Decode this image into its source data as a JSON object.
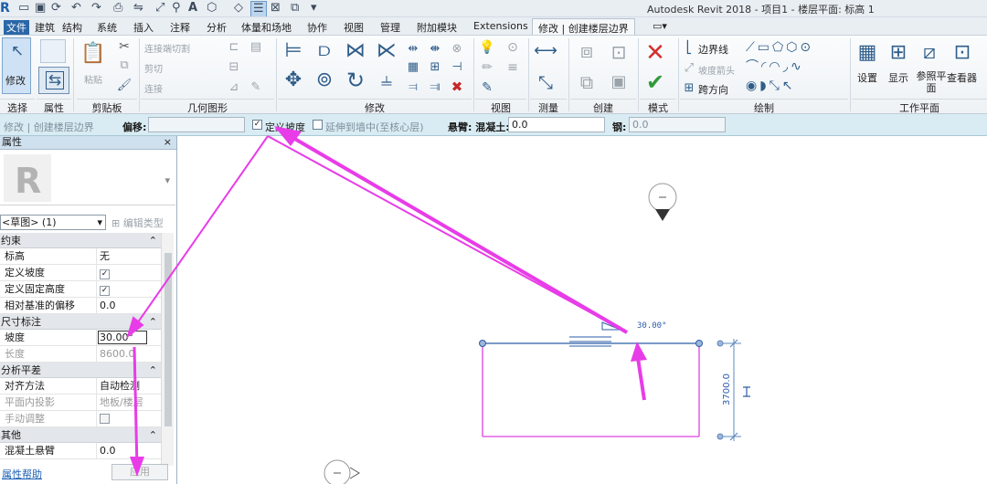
{
  "titlebar": {
    "logo": "R",
    "title": "Autodesk Revit 2018 -    项目1 - 楼层平面: 标高 1"
  },
  "tabs": [
    "文件",
    "建筑",
    "结构",
    "系统",
    "插入",
    "注释",
    "分析",
    "体量和场地",
    "协作",
    "视图",
    "管理",
    "附加模块",
    "Extensions",
    "修改 | 创建楼层边界"
  ],
  "ribbon": {
    "modify": "修改",
    "select": "选择",
    "properties": "属性",
    "paste": "粘贴",
    "clipboard": "剪贴板",
    "cut_join": "连接端切割",
    "cut": "剪切",
    "join": "连接",
    "geometry": "几何图形",
    "modify_panel": "修改",
    "view": "视图",
    "measure": "测量",
    "create": "创建",
    "mode": "模式",
    "boundary_line": "边界线",
    "slope_arrow": "坡度箭头",
    "span_direction": "跨方向",
    "draw": "绘制",
    "set": "设置",
    "show": "显示",
    "ref_plane": "参照平面",
    "viewer": "查看器",
    "work_plane": "工作平面"
  },
  "options": {
    "context": "修改 | 创建楼层边界",
    "offset_label": "偏移:",
    "define_slope": "定义坡度",
    "define_slope_checked": true,
    "extend_wall": "延伸到墙中(至核心层)",
    "cantilever_concrete_label": "悬臂: 混凝土:",
    "cantilever_concrete": "0.0",
    "steel_label": "钢:",
    "steel": "0.0"
  },
  "properties": {
    "title": "属性",
    "close": "×",
    "instance": "<草图> (1)",
    "edit_type": "编辑类型",
    "sections": [
      {
        "name": "约束",
        "rows": [
          {
            "key": "标高",
            "value": "无"
          },
          {
            "key": "定义坡度",
            "checkbox": true
          },
          {
            "key": "定义固定高度",
            "checkbox": true
          },
          {
            "key": "相对基准的偏移",
            "value": "0.0"
          }
        ]
      },
      {
        "name": "尺寸标注",
        "rows": [
          {
            "key": "坡度",
            "value": "30.00°",
            "editing": true
          },
          {
            "key": "长度",
            "value": "8600.0",
            "dim": true
          }
        ]
      },
      {
        "name": "分析平差",
        "rows": [
          {
            "key": "对齐方法",
            "value": "自动检测"
          },
          {
            "key": "平面内投影",
            "value": "地板/楼层",
            "dim": true
          },
          {
            "key": "手动调整",
            "checkbox": false,
            "dim": true
          }
        ]
      },
      {
        "name": "其他",
        "rows": [
          {
            "key": "混凝土悬臂",
            "value": "0.0"
          }
        ]
      }
    ],
    "help": "属性帮助",
    "apply": "应用"
  },
  "canvas": {
    "slope_label": "30.00°",
    "dimension": "3700.0"
  },
  "colors": {
    "annotation_arrow": "#e83ce8",
    "sketch_line": "#e040e0",
    "selection_blue": "#2a5da8"
  }
}
